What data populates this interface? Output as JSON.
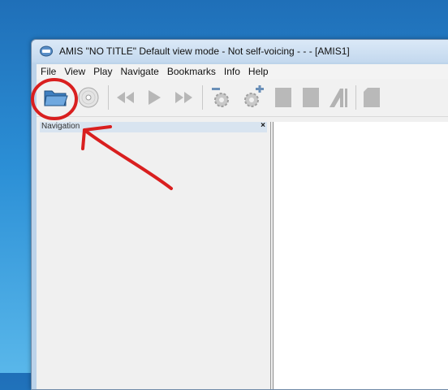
{
  "window": {
    "title": "AMIS \"NO TITLE\" Default view mode - Not self-voicing - - - [AMIS1]"
  },
  "menu": [
    "File",
    "View",
    "Play",
    "Navigate",
    "Bookmarks",
    "Info",
    "Help"
  ],
  "toolbar": {
    "buttons": [
      {
        "name": "open-file-button",
        "icon": "folder-open-icon"
      },
      {
        "name": "open-cd-button",
        "icon": "cd-disc-icon"
      },
      {
        "name": "previous-button",
        "icon": "rewind-icon"
      },
      {
        "name": "play-button",
        "icon": "play-icon"
      },
      {
        "name": "next-button",
        "icon": "fast-forward-icon"
      },
      {
        "name": "decrease-button",
        "icon": "gear-minus-icon"
      },
      {
        "name": "increase-button",
        "icon": "gear-plus-icon"
      },
      {
        "name": "toolbar-button-8",
        "icon": "blank-page-icon"
      },
      {
        "name": "toolbar-button-9",
        "icon": "blank-page-icon"
      },
      {
        "name": "toolbar-button-10",
        "icon": "text-style-icon"
      },
      {
        "name": "toolbar-button-11",
        "icon": "page-icon"
      }
    ]
  },
  "navigation": {
    "title": "Navigation",
    "close_label": "×"
  },
  "colors": {
    "annotation": "#d91f1f"
  }
}
